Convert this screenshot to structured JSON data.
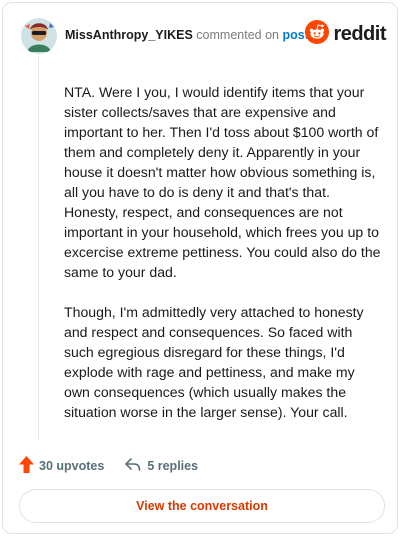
{
  "comment": {
    "username": "MissAnthropy_YIKES",
    "action_text": "commented on",
    "post_link": "post",
    "paragraphs": [
      "NTA. Were I you, I would identify items that your sister collects/saves that are expensive and important to her. Then I'd toss about $100 worth of them and completely deny it. Apparently in your house it doesn't matter how obvious something is, all you have to do is deny it and that's that. Honesty, respect, and consequences are not important in your household, which frees you up to excercise extreme pettiness. You could also do the same to your dad.",
      "Though, I'm admittedly very attached to honesty and respect and consequences. So faced with such egregious disregard for these things, I'd explode with rage and pettiness, and make my own consequences (which usually makes the situation worse in the larger sense). Your call."
    ],
    "upvotes_label": "30 upvotes",
    "replies_label": "5 replies"
  },
  "brand": {
    "name": "reddit",
    "color": "#ff4500"
  },
  "icons": {
    "upvote": "upvote-arrow-icon",
    "reply": "reply-arrow-icon",
    "logo": "reddit-alien-icon",
    "avatar": "user-avatar"
  },
  "footer": {
    "view_button_label": "View the conversation"
  },
  "colors": {
    "link": "#0079d3",
    "upvote": "#ff4500",
    "cta": "#d93900",
    "muted": "#576f76"
  }
}
